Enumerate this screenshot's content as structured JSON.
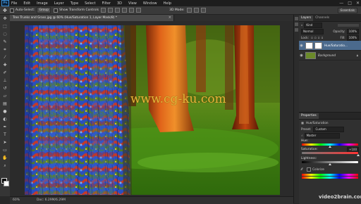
{
  "app": {
    "logo": "Ps"
  },
  "menu": {
    "items": [
      {
        "label": "File"
      },
      {
        "label": "Edit"
      },
      {
        "label": "Image"
      },
      {
        "label": "Layer"
      },
      {
        "label": "Type"
      },
      {
        "label": "Select"
      },
      {
        "label": "Filter"
      },
      {
        "label": "3D"
      },
      {
        "label": "View"
      },
      {
        "label": "Window"
      },
      {
        "label": "Help"
      }
    ],
    "window_controls": [
      "—",
      "□",
      "✕"
    ]
  },
  "options_bar": {
    "auto_select_label": "Auto-Select:",
    "auto_select_value": "Group",
    "show_transform_label": "Show Transform Controls",
    "mode_3d_label": "3D Mode:",
    "workspace": "Essentials"
  },
  "tools": [
    "move-icon",
    "marquee-icon",
    "lasso-icon",
    "quick-select-icon",
    "crop-icon",
    "eyedropper-icon",
    "healing-icon",
    "brush-icon",
    "clone-icon",
    "history-brush-icon",
    "eraser-icon",
    "gradient-icon",
    "blur-icon",
    "dodge-icon",
    "pen-icon",
    "type-icon",
    "path-select-icon",
    "shape-icon",
    "hand-icon",
    "zoom-icon"
  ],
  "document": {
    "tab_title": "Tree Trunks and Grass.jpg @ 60% (Hue/Saturation 1, Layer Mask/8) *",
    "close_glyph": "×",
    "zoom": "60%",
    "doc_size": "Doc: 6.29M/6.29M"
  },
  "watermark": "www.cg-ku.com",
  "layers_panel": {
    "tabs": [
      "Layers",
      "Channels"
    ],
    "kind_label": "Kind",
    "blend_mode": "Normal",
    "opacity_label": "Opacity:",
    "opacity_value": "100%",
    "lock_label": "Lock:",
    "fill_label": "Fill:",
    "fill_value": "100%",
    "layers": [
      {
        "name": "Hue/Saturatio...",
        "selected": true
      },
      {
        "name": "Background",
        "selected": false
      }
    ]
  },
  "properties_panel": {
    "tab": "Properties",
    "title": "Hue/Saturation",
    "preset_label": "Preset:",
    "preset_value": "Custom",
    "channel_value": "Master",
    "hue_label": "Hue:",
    "hue_value": "0",
    "saturation_label": "Saturation:",
    "saturation_value": "+100",
    "lightness_label": "Lightness:",
    "lightness_value": "0",
    "colorize_label": "Colorize",
    "hue_position": 0.5,
    "saturation_position": 1.0,
    "lightness_position": 0.5
  },
  "footer_brand": "video2brain.com"
}
